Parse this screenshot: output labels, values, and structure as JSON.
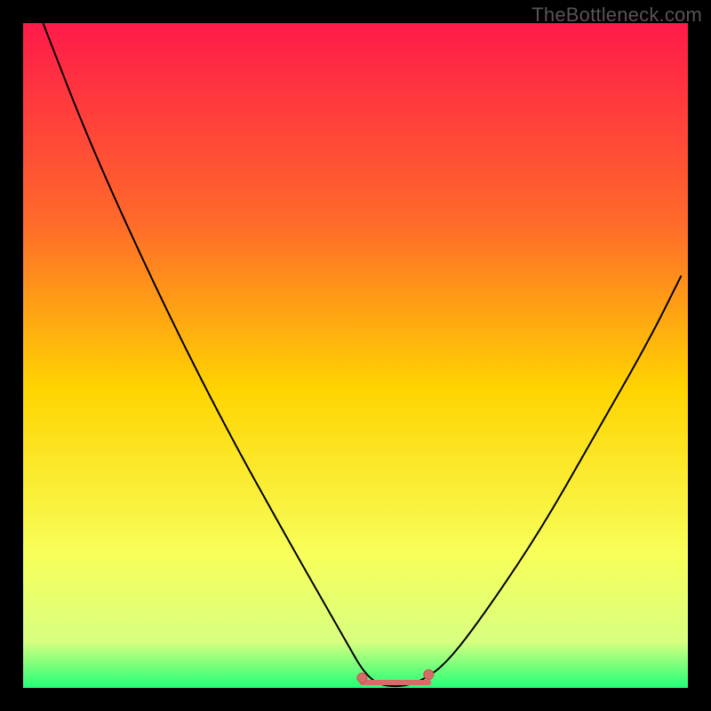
{
  "watermark": "TheBottleneck.com",
  "colors": {
    "black": "#000000",
    "curve": "#000000",
    "marker_fill": "#d96a6a",
    "marker_stroke": "#c94f4f",
    "grad_top": "#ff1a4a",
    "grad_mid1": "#ff6a2a",
    "grad_mid2": "#ffd400",
    "grad_mid3": "#f7ff5a",
    "grad_bot": "#22ff77"
  },
  "chart_data": {
    "type": "line",
    "title": "",
    "xlabel": "",
    "ylabel": "",
    "xlim": [
      0,
      100
    ],
    "ylim": [
      0,
      100
    ],
    "grid": false,
    "notes": "Axes unlabeled in source image; x/y are normalized 0-100. Curve is a bottleneck-style V with flat minimum region near x≈52-60 at y≈0.",
    "series": [
      {
        "name": "curve",
        "x": [
          3,
          10,
          20,
          30,
          40,
          48,
          52,
          56,
          60,
          64,
          70,
          78,
          86,
          94,
          99
        ],
        "y": [
          100,
          82,
          60,
          40,
          22,
          8,
          1,
          0,
          1,
          4,
          12,
          24,
          38,
          52,
          62
        ]
      }
    ],
    "flat_region": {
      "x_start": 51,
      "x_end": 61,
      "y": 0.8
    },
    "markers": [
      {
        "x": 51,
        "y": 1.5
      },
      {
        "x": 61,
        "y": 2.0
      }
    ],
    "background_gradient_stops": [
      {
        "offset": 0.0,
        "color": "#ff1a4a"
      },
      {
        "offset": 0.3,
        "color": "#ff6a2a"
      },
      {
        "offset": 0.55,
        "color": "#ffd400"
      },
      {
        "offset": 0.8,
        "color": "#f7ff5a"
      },
      {
        "offset": 0.93,
        "color": "#d8ff80"
      },
      {
        "offset": 1.0,
        "color": "#22ff77"
      }
    ]
  }
}
